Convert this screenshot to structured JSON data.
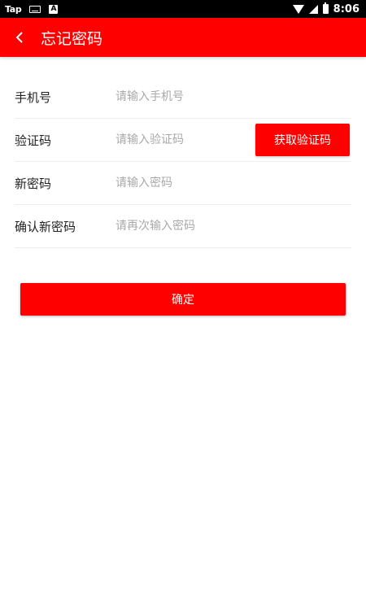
{
  "status_bar": {
    "left_app_label": "Tap",
    "time": "8:06",
    "icons": [
      "keyboard-icon",
      "a-icon",
      "wifi-icon",
      "signal-icon",
      "battery-icon"
    ]
  },
  "header": {
    "title": "忘记密码",
    "back_icon": "chevron-left-icon"
  },
  "form": {
    "phone": {
      "label": "手机号",
      "placeholder": "请输入手机号",
      "value": ""
    },
    "code": {
      "label": "验证码",
      "placeholder": "请输入验证码",
      "value": "",
      "button_label": "获取验证码"
    },
    "new_password": {
      "label": "新密码",
      "placeholder": "请输入密码",
      "value": ""
    },
    "confirm_password": {
      "label": "确认新密码",
      "placeholder": "请再次输入密码",
      "value": ""
    }
  },
  "confirm_label": "确定",
  "colors": {
    "accent": "#ff0000",
    "placeholder": "#a9a9a9",
    "divider": "#eeeeee"
  }
}
